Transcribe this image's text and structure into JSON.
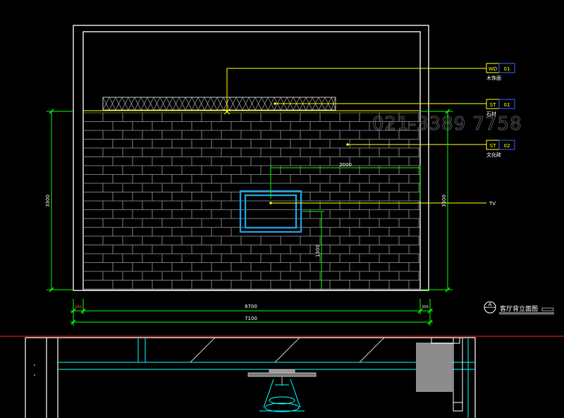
{
  "drawing": {
    "watermark": "021-3389 7758",
    "title_circle": "A",
    "title_text": "客厅背立面图",
    "dim_total": "7100",
    "dim_inner": "6700",
    "dim_left_small": "200",
    "dim_right_small": "200",
    "dim_height_left": "3300",
    "dim_height_right": "3300",
    "dim_tv_width": "3000",
    "dim_tv_height": "1300",
    "tags": [
      {
        "code": "WD",
        "num": "01",
        "label": "木饰面"
      },
      {
        "code": "ST",
        "num": "01",
        "label": "石材"
      },
      {
        "code": "ST",
        "num": "02",
        "label": "文化砖"
      }
    ],
    "tv_label": "TV"
  },
  "colors": {
    "background": "#000000",
    "frame": "#ffffff",
    "brick": "#9a9a9a",
    "leader": "#ffff00",
    "dimension": "#00ff00",
    "tv": "#1e9bd7",
    "tag_box": "#4060ff",
    "section_line": "#ff2020",
    "plan": "#00ffff",
    "plan_gray": "#8c8c8c"
  }
}
